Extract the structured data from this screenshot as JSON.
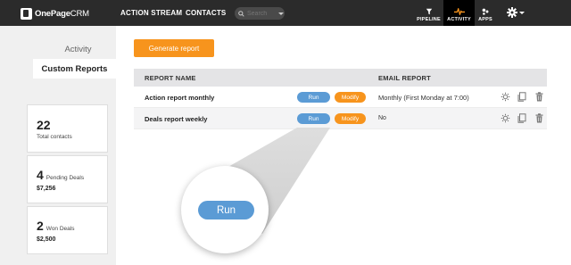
{
  "topbar": {
    "logo_bold": "OnePage",
    "logo_light": "CRM",
    "nav": [
      "ACTION STREAM",
      "CONTACTS"
    ],
    "search_placeholder": "Search",
    "right_nav": [
      {
        "label": "PIPELINE",
        "icon": "filter-icon"
      },
      {
        "label": "ACTIVITY",
        "icon": "activity-pulse-icon",
        "active": true
      },
      {
        "label": "APPS",
        "icon": "apps-icon"
      }
    ]
  },
  "sidebar": {
    "tabs": [
      "Activity",
      "Custom Reports"
    ],
    "active_tab": "Custom Reports",
    "stats": [
      {
        "value": "22",
        "label": "Total contacts"
      },
      {
        "value": "4",
        "label": "Pending Deals",
        "amount": "$7,256"
      },
      {
        "value": "2",
        "label": "Won Deals",
        "amount": "$2,500"
      }
    ]
  },
  "main": {
    "generate_button": "Generate report",
    "table": {
      "headers": [
        "REPORT NAME",
        "EMAIL REPORT"
      ],
      "rows": [
        {
          "name": "Action report monthly",
          "run": "Run",
          "modify": "Modify",
          "email": "Monthly (First Monday at 7:00)"
        },
        {
          "name": "Deals report weekly",
          "run": "Run",
          "modify": "Modify",
          "email": "No"
        }
      ]
    }
  },
  "zoom_callout": {
    "label": "Run"
  },
  "colors": {
    "topbar": "#2b2b2b",
    "accent_orange": "#f7941d",
    "run_blue": "#5b9bd5",
    "sidebar_bg": "#f0f0f0",
    "header_bg": "#e4e4e6"
  }
}
